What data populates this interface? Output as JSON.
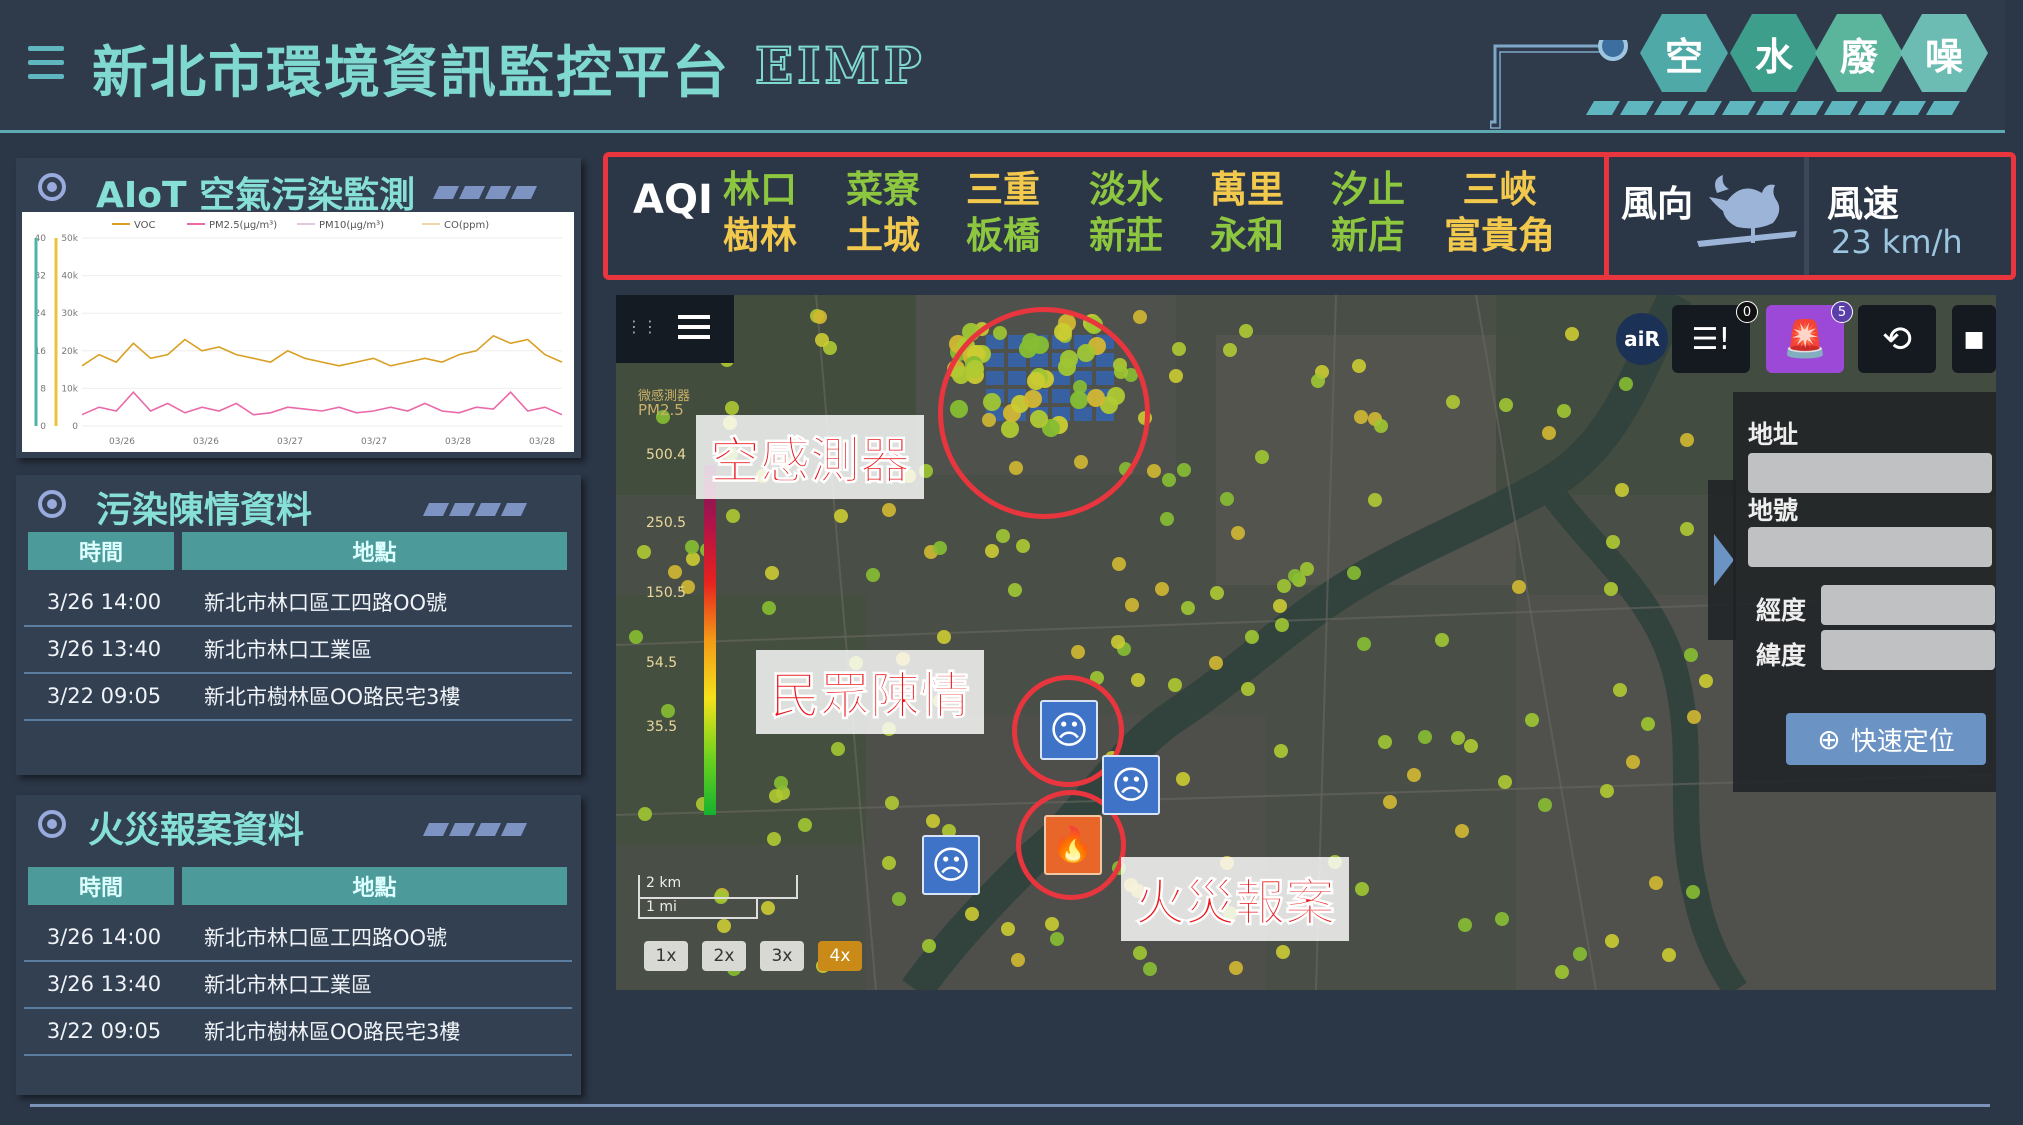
{
  "header": {
    "title": "新北市環境資訊監控平台",
    "subtitle": "EIMP",
    "categories": [
      {
        "label": "空",
        "color": "#4fa9a7"
      },
      {
        "label": "水",
        "color": "#3d9e8c"
      },
      {
        "label": "廢",
        "color": "#5bb59c"
      },
      {
        "label": "噪",
        "color": "#6cbcb4"
      }
    ]
  },
  "aiot_panel": {
    "title": "AIoT 空氣污染監測",
    "chart_data": {
      "type": "line",
      "legend": [
        "VOC",
        "PM2.5(μg/m³)",
        "PM10(μg/m³)",
        "CO(ppm)"
      ],
      "y_left_ticks": [
        "40",
        "32",
        "24",
        "16",
        "8",
        "0"
      ],
      "y_right_ticks": [
        "50k",
        "40k",
        "30k",
        "20k",
        "10k",
        "0"
      ],
      "x_ticks": [
        "03/26",
        "03/26",
        "03/27",
        "03/27",
        "03/28",
        "03/28"
      ],
      "ylim": [
        0,
        50000
      ],
      "series": [
        {
          "name": "VOC",
          "color": "#d9a024",
          "values": [
            16000,
            19000,
            17000,
            22000,
            18000,
            19000,
            23000,
            20000,
            21000,
            19000,
            18000,
            17000,
            20000,
            18000,
            17000,
            16000,
            17000,
            18000,
            16000,
            17000,
            18000,
            17000,
            19000,
            20000,
            24000,
            22000,
            23000,
            19000,
            17000
          ]
        },
        {
          "name": "PM2.5(μg/m³)",
          "color": "#e96aa8",
          "values": [
            3000,
            5000,
            4000,
            9000,
            4000,
            6000,
            3500,
            5000,
            4000,
            6000,
            3000,
            3500,
            5000,
            4500,
            4000,
            5000,
            3500,
            4000,
            5000,
            4000,
            6000,
            4000,
            3500,
            5000,
            4500,
            9000,
            4000,
            5000,
            3000
          ]
        }
      ]
    }
  },
  "complaint_panel": {
    "title": "污染陳情資料",
    "columns": [
      "時間",
      "地點"
    ],
    "rows": [
      [
        "3/26 14:00",
        "新北市林口區工四路OO號"
      ],
      [
        "3/26 13:40",
        "新北市林口工業區"
      ],
      [
        "3/22 09:05",
        "新北市樹林區OO路民宅3樓"
      ]
    ]
  },
  "fire_panel": {
    "title": "火災報案資料",
    "columns": [
      "時間",
      "地點"
    ],
    "rows": [
      [
        "3/26 14:00",
        "新北市林口區工四路OO號"
      ],
      [
        "3/26 13:40",
        "新北市林口工業區"
      ],
      [
        "3/22 09:05",
        "新北市樹林區OO路民宅3樓"
      ]
    ]
  },
  "aqi": {
    "label": "AQI",
    "cities": [
      {
        "top": "林口",
        "bottom": "樹林",
        "top_color": "#8dc63f",
        "bottom_color": "#f2c94c"
      },
      {
        "top": "菜寮",
        "bottom": "土城",
        "top_color": "#8dc63f",
        "bottom_color": "#f2c94c"
      },
      {
        "top": "三重",
        "bottom": "板橋",
        "top_color": "#f2c94c",
        "bottom_color": "#8dc63f"
      },
      {
        "top": "淡水",
        "bottom": "新莊",
        "top_color": "#8dc63f",
        "bottom_color": "#8dc63f"
      },
      {
        "top": "萬里",
        "bottom": "永和",
        "top_color": "#f2c94c",
        "bottom_color": "#8dc63f"
      },
      {
        "top": "汐止",
        "bottom": "新店",
        "top_color": "#8dc63f",
        "bottom_color": "#8dc63f"
      },
      {
        "top": "三峽",
        "bottom": "富貴角",
        "top_color": "#f2c94c",
        "bottom_color": "#f2c94c"
      }
    ]
  },
  "wind": {
    "direction_label": "風向",
    "speed_label": "風速",
    "speed_value": "23 km/h"
  },
  "map": {
    "legend_title": "微感測器",
    "legend_unit": "PM2.5",
    "legend_ticks": [
      "500.4",
      "250.5",
      "150.5",
      "54.5",
      "35.5"
    ],
    "scale_km": "2 km",
    "scale_mi": "1 mi",
    "zoom_levels": [
      "1x",
      "2x",
      "3x",
      "4x"
    ],
    "active_zoom": "4x",
    "air_logo": "aiR",
    "badge_report": "0",
    "badge_alarm": "5",
    "side_panel": {
      "address_label": "地址",
      "number_label": "地號",
      "lng_label": "經度",
      "lat_label": "緯度",
      "locate_button": "快速定位"
    },
    "callouts": {
      "sensor": "空感測器",
      "complaint": "民眾陳情",
      "fire": "火災報案"
    }
  }
}
